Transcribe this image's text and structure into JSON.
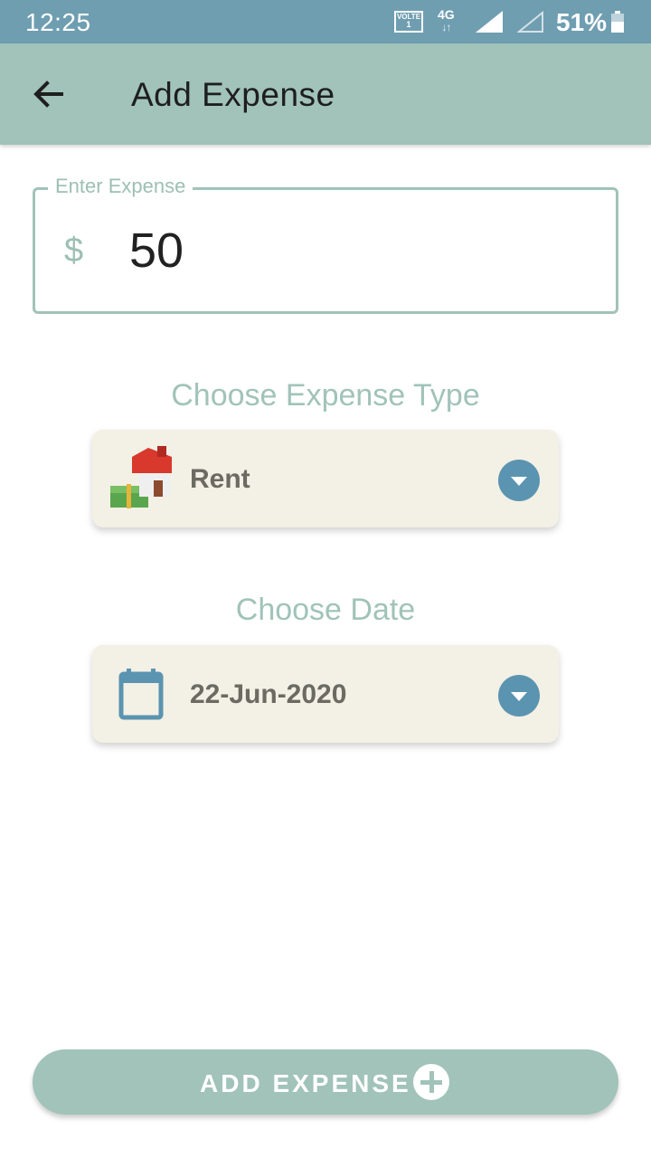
{
  "status_bar": {
    "time": "12:25",
    "volte": "VOLTE",
    "volte_sim": "1",
    "network": "4G",
    "network_arrows": "↓↑",
    "battery": "51%"
  },
  "app_bar": {
    "title": "Add Expense",
    "back_icon": "arrow-left-icon"
  },
  "expense_field": {
    "label": "Enter Expense",
    "currency": "$",
    "value": "50"
  },
  "expense_type": {
    "heading": "Choose Expense Type",
    "selected": "Rent",
    "icon": "house-money-icon"
  },
  "date": {
    "heading": "Choose Date",
    "selected": "22-Jun-2020",
    "icon": "calendar-icon"
  },
  "add_button": {
    "label": "ADD EXPENSE",
    "icon": "plus-circle-icon"
  },
  "colors": {
    "status_bar": "#6f9eb1",
    "app_bar": "#a1c3b9",
    "card": "#f3f0e5",
    "dropdown_caret": "#5b94b0"
  }
}
